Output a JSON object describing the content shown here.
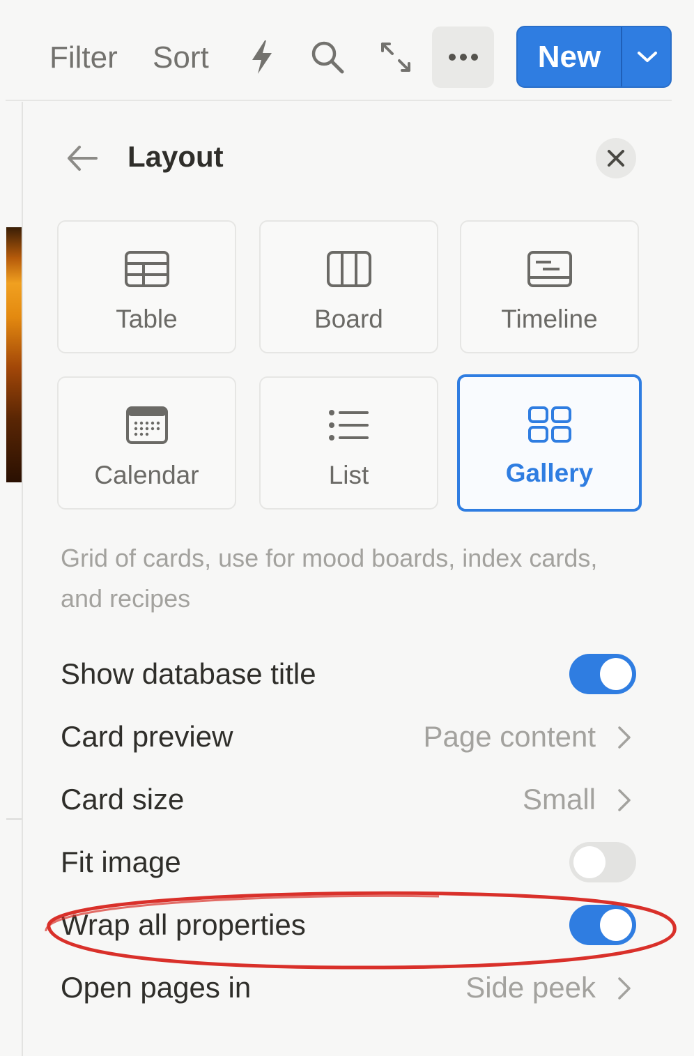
{
  "toolbar": {
    "filter_label": "Filter",
    "sort_label": "Sort",
    "icons": [
      "lightning-icon",
      "search-icon",
      "expand-icon",
      "more-icon"
    ],
    "new_label": "New"
  },
  "panel": {
    "title": "Layout",
    "layouts": [
      {
        "label": "Table",
        "icon": "table-icon",
        "selected": false
      },
      {
        "label": "Board",
        "icon": "board-icon",
        "selected": false
      },
      {
        "label": "Timeline",
        "icon": "timeline-icon",
        "selected": false
      },
      {
        "label": "Calendar",
        "icon": "calendar-icon",
        "selected": false
      },
      {
        "label": "List",
        "icon": "list-icon",
        "selected": false
      },
      {
        "label": "Gallery",
        "icon": "gallery-icon",
        "selected": true
      }
    ],
    "description": "Grid of cards, use for mood boards, index cards, and recipes",
    "settings": {
      "show_title": {
        "label": "Show database title",
        "on": true
      },
      "card_preview": {
        "label": "Card preview",
        "value": "Page content"
      },
      "card_size": {
        "label": "Card size",
        "value": "Small"
      },
      "fit_image": {
        "label": "Fit image",
        "on": false
      },
      "wrap_props": {
        "label": "Wrap all properties",
        "on": true
      },
      "open_pages": {
        "label": "Open pages in",
        "value": "Side peek"
      }
    }
  },
  "colors": {
    "accent": "#2f7de1",
    "annotation": "#d9302a",
    "toggle_off": "#e3e3e1"
  }
}
